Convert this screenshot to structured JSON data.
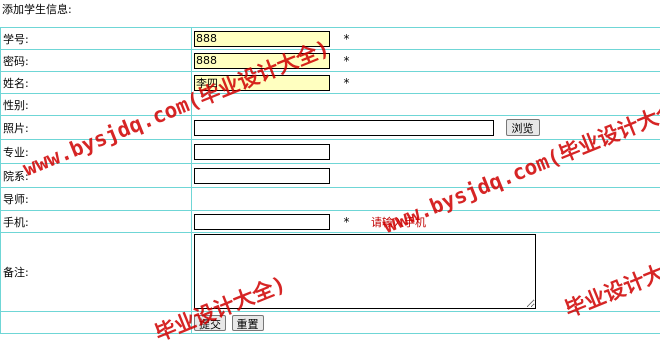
{
  "heading": "添加学生信息:",
  "fields": {
    "student_id": {
      "label": "学号:",
      "value": "888",
      "required": "*"
    },
    "password": {
      "label": "密码:",
      "value": "888",
      "required": "*"
    },
    "name": {
      "label": "姓名:",
      "value": "李四",
      "required": "*"
    },
    "gender": {
      "label": "性别:"
    },
    "photo": {
      "label": "照片:",
      "button": "浏览"
    },
    "major": {
      "label": "专业:",
      "value": ""
    },
    "department": {
      "label": "院系:",
      "value": ""
    },
    "advisor": {
      "label": "导师:"
    },
    "phone": {
      "label": "手机:",
      "value": "",
      "required": "*",
      "hint": "请输入手机"
    },
    "remarks": {
      "label": "备注:",
      "value": ""
    }
  },
  "buttons": {
    "submit": "提交",
    "reset": "重置"
  },
  "watermark": {
    "site": "www.bysjdq.com(毕业设计大全)",
    "brand": "毕业设计大全)"
  },
  "colors": {
    "border": "#6fd6d6",
    "filled_input": "#ffffc0",
    "hint": "#c00000",
    "watermark": "#d00000"
  }
}
